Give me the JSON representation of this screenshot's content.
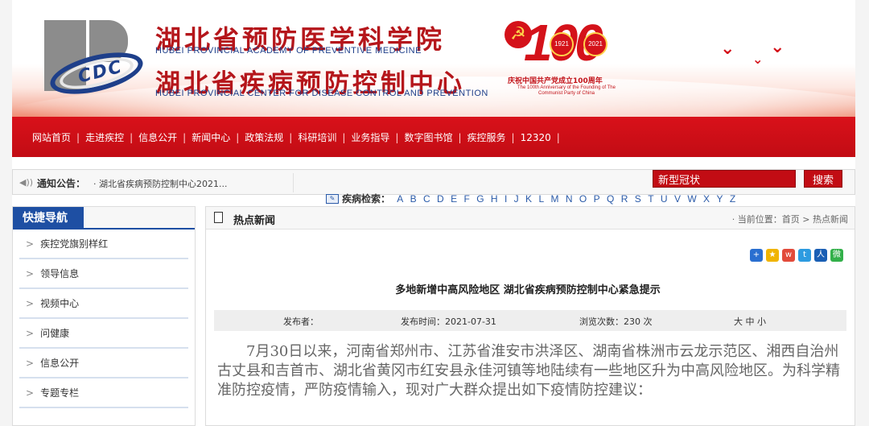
{
  "header": {
    "title_cn_1": "湖北省预防医学科学院",
    "title_en_1": "HUBEI PROVINCIAL ACADEMY OF PREVENTIVE MEDICINE",
    "title_cn_2": "湖北省疾病预防控制中心",
    "title_en_2": "HUBEI PROVINCIAL CENTER FOR DISEASE CONTROL AND PREVENTION",
    "logo_text": "CDC",
    "anniversary": {
      "number": "100",
      "year_start": "1921",
      "year_end": "2021",
      "caption_cn": "庆祝中国共产党成立100周年",
      "caption_en": "The 100th Anniversary of the Founding of The Communist Party of China"
    }
  },
  "nav": {
    "items": [
      "网站首页",
      "走进疾控",
      "信息公开",
      "新闻中心",
      "政策法规",
      "科研培训",
      "业务指导",
      "数字图书馆",
      "疾控服务",
      "12320"
    ],
    "separator": "|"
  },
  "notice": {
    "label": "通知公告：",
    "text": "· 湖北省疾病预防控制中心2021..."
  },
  "search": {
    "value": "新型冠状",
    "button_label": "搜索"
  },
  "disease_index": {
    "label": "疾病检索：",
    "letters": [
      "A",
      "B",
      "C",
      "D",
      "E",
      "F",
      "G",
      "H",
      "I",
      "J",
      "K",
      "L",
      "M",
      "N",
      "O",
      "P",
      "Q",
      "R",
      "S",
      "T",
      "U",
      "V",
      "W",
      "X",
      "Y",
      "Z"
    ]
  },
  "sidebar": {
    "title": "快捷导航",
    "items": [
      {
        "label": "疾控党旗别样红"
      },
      {
        "label": "领导信息"
      },
      {
        "label": "视频中心"
      },
      {
        "label": "问健康"
      },
      {
        "label": "信息公开"
      },
      {
        "label": "专题专栏"
      }
    ],
    "chevron": ">"
  },
  "main": {
    "section_title": "热点新闻",
    "breadcrumb": "· 当前位置：首页 > 热点新闻",
    "article_title": "多地新增中高风险地区 湖北省疾病预防控制中心紧急提示",
    "meta": {
      "publisher": "发布者：",
      "publish_time": "发布时间：2021-07-31",
      "views": "浏览次数：230 次",
      "font_size": "大 中 小"
    },
    "body": "7月30日以来，河南省郑州市、江苏省淮安市洪泽区、湖南省株洲市云龙示范区、湘西自治州古丈县和吉首市、湖北省黄冈市红安县永佳河镇等地陆续有一些地区升为中高风险地区。为科学精准防控疫情，严防疫情输入，现对广大群众提出如下疫情防控建议："
  },
  "share_icons": [
    {
      "name": "share-plus-icon",
      "color": "#2a6fd0",
      "glyph": "+"
    },
    {
      "name": "qzone-icon",
      "color": "#f0b400",
      "glyph": "★"
    },
    {
      "name": "weibo-icon",
      "color": "#e24b3b",
      "glyph": "w"
    },
    {
      "name": "tencent-weibo-icon",
      "color": "#2d9be0",
      "glyph": "t"
    },
    {
      "name": "renren-icon",
      "color": "#1a5fb4",
      "glyph": "人"
    },
    {
      "name": "wechat-icon",
      "color": "#33b04a",
      "glyph": "微"
    }
  ]
}
